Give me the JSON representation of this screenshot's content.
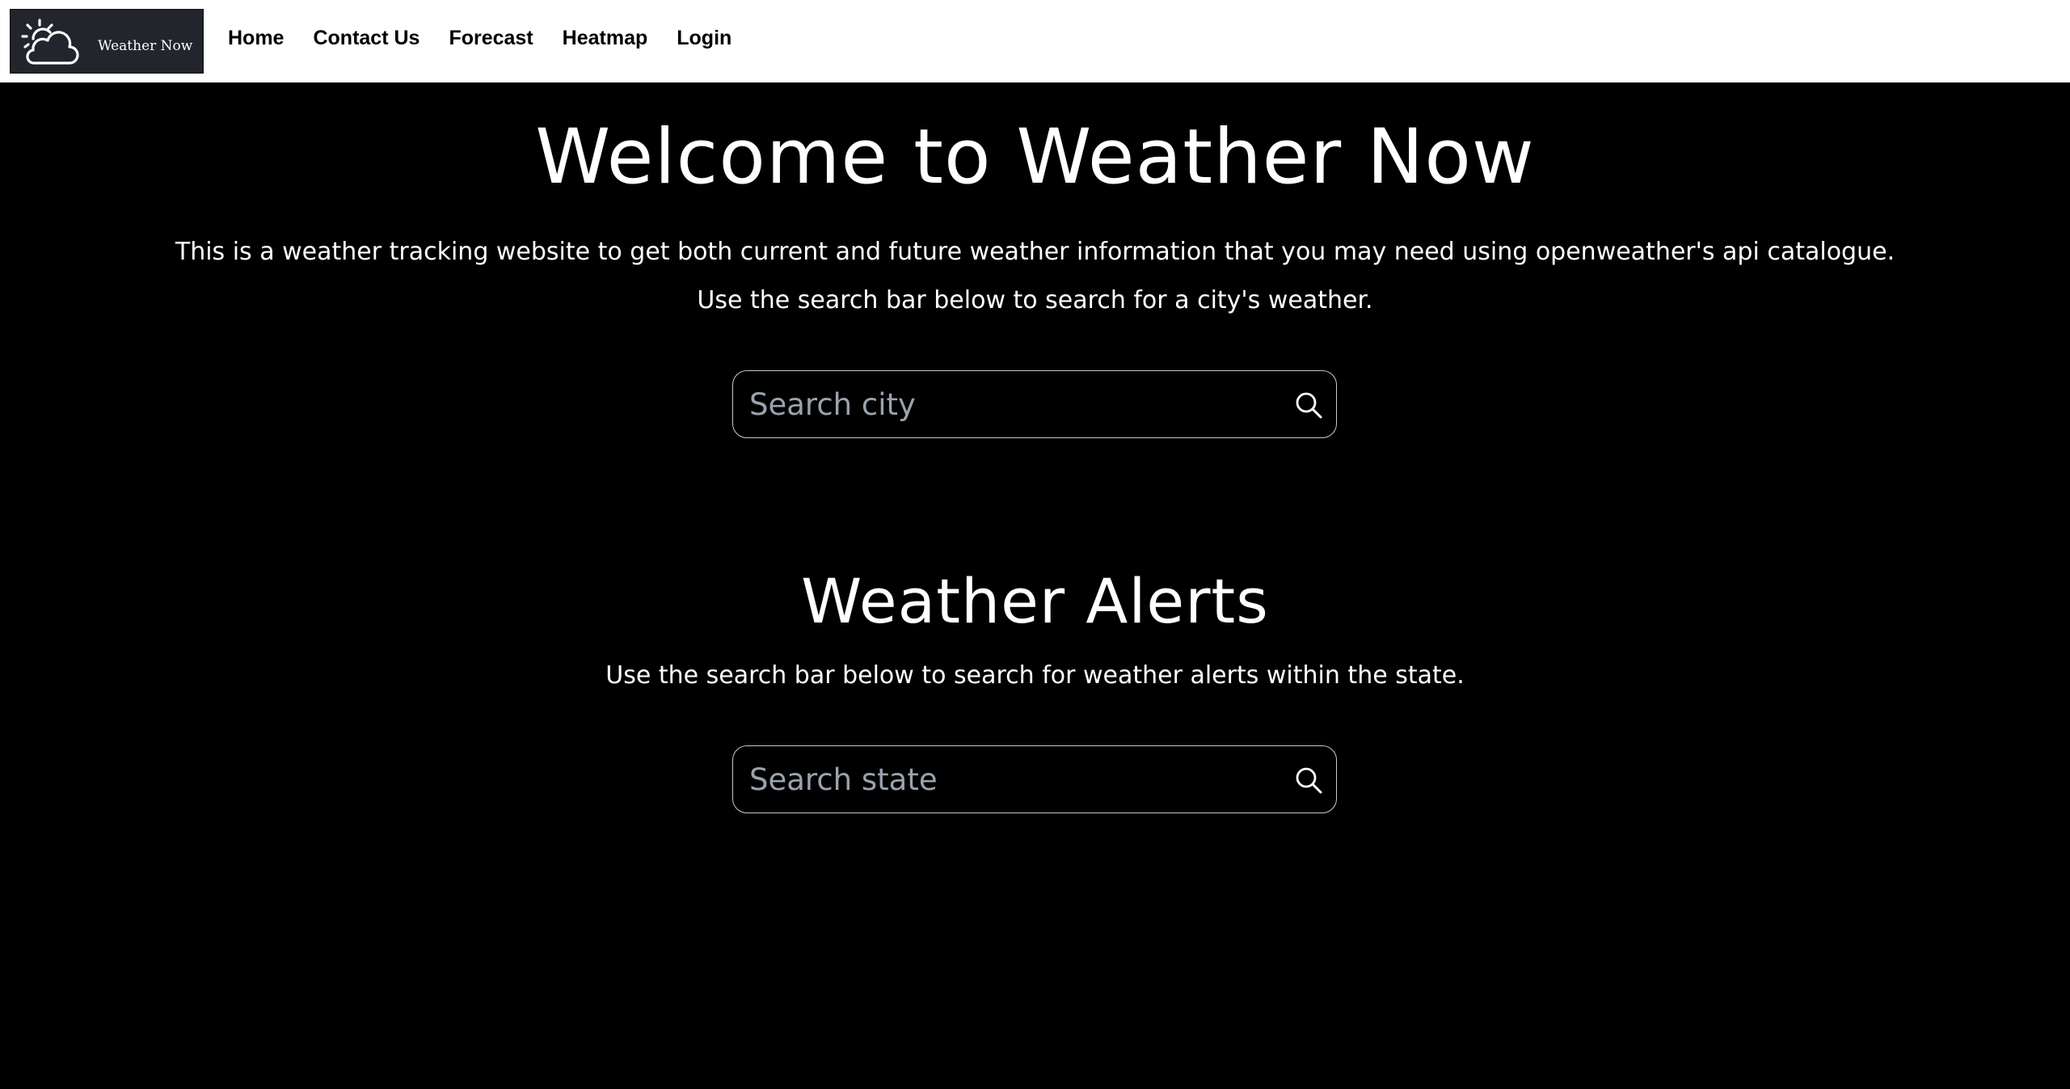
{
  "nav": {
    "logo_text": "Weather Now",
    "logo_icon": "sun-cloud-icon",
    "links": [
      "Home",
      "Contact Us",
      "Forecast",
      "Heatmap",
      "Login"
    ]
  },
  "main": {
    "title": "Welcome to Weather Now",
    "intro": "This is a weather tracking website to get both current and future weather information that you may need using openweather's api catalogue.",
    "city_instruction": "Use the search bar below to search for a city's weather.",
    "city_search": {
      "placeholder": "Search city",
      "value": "",
      "icon": "search-icon"
    },
    "alerts_title": "Weather Alerts",
    "alerts_instruction": "Use the search bar below to search for weather alerts within the state.",
    "state_search": {
      "placeholder": "Search state",
      "value": "",
      "icon": "search-icon"
    }
  },
  "colors": {
    "navbar_bg": "#ffffff",
    "page_bg": "#000000",
    "logo_bg": "#22252b",
    "text": "#ffffff",
    "placeholder": "#9aa3ad",
    "search_border": "#c9c9c9"
  }
}
